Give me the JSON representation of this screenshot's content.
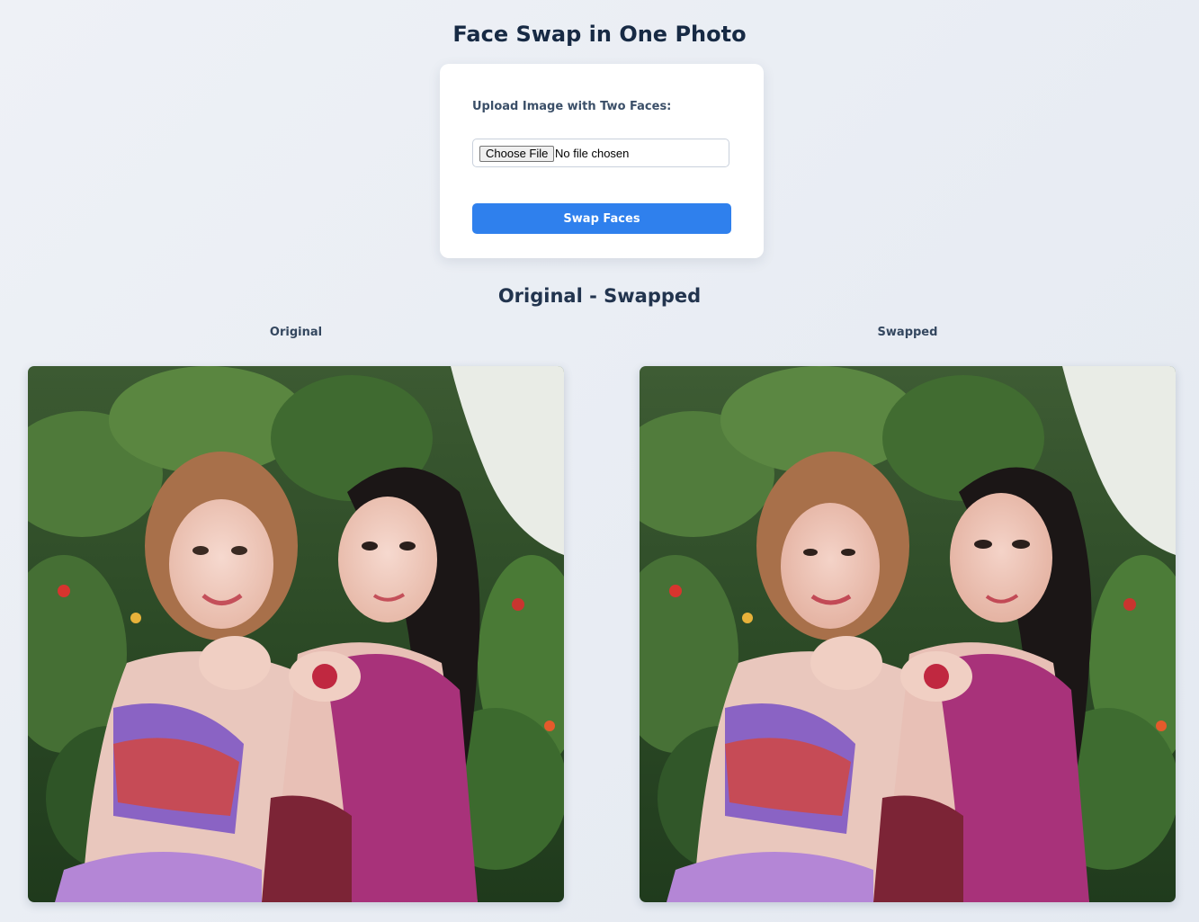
{
  "page": {
    "title": "Face Swap in One Photo"
  },
  "upload": {
    "label": "Upload Image with Two Faces:",
    "choose_file_label": "Choose File",
    "no_file_text": "No file chosen",
    "submit_label": "Swap Faces"
  },
  "results": {
    "heading": "Original - Swapped",
    "original_label": "Original",
    "swapped_label": "Swapped"
  },
  "colors": {
    "accent": "#2f80ed",
    "background": "#e8ecf2",
    "title": "#172a44"
  }
}
